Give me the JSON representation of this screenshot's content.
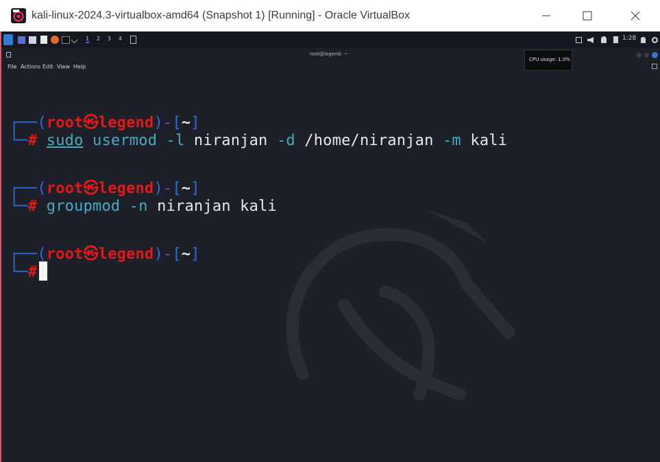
{
  "window": {
    "title": "kali-linux-2024.3-virtualbox-amd64 (Snapshot 1) [Running] - Oracle VirtualBox",
    "icon": "virtualbox-icon"
  },
  "kali_panel": {
    "workspaces": [
      "1",
      "2",
      "3",
      "4"
    ],
    "active_workspace": "1",
    "clock": "1:28"
  },
  "terminal": {
    "title": "root@legend: ~",
    "menu": [
      "File",
      "Actions",
      "Edit",
      "View",
      "Help"
    ],
    "tooltip": "CPU usage: 1.0%",
    "prompt": {
      "open": "┌──(",
      "user": "root",
      "at": "㉿",
      "host": "legend",
      "mid": ")-[",
      "dir": "~",
      "close": "]",
      "line2": "└─",
      "hash": "#"
    },
    "commands": [
      {
        "parts": [
          {
            "text": "sudo",
            "cls": "cmd ul"
          },
          {
            "text": " usermod",
            "cls": "cmd"
          },
          {
            "text": " -l",
            "cls": "opt"
          },
          {
            "text": " niranjan",
            "cls": "arg"
          },
          {
            "text": " -d",
            "cls": "opt"
          },
          {
            "text": " /home/niranjan",
            "cls": "arg"
          },
          {
            "text": " -m",
            "cls": "opt"
          },
          {
            "text": " kali",
            "cls": "arg"
          }
        ]
      },
      {
        "parts": [
          {
            "text": "groupmod",
            "cls": "cmd"
          },
          {
            "text": " -n",
            "cls": "opt"
          },
          {
            "text": " niranjan",
            "cls": "arg"
          },
          {
            "text": " kali",
            "cls": "arg"
          }
        ]
      }
    ]
  }
}
